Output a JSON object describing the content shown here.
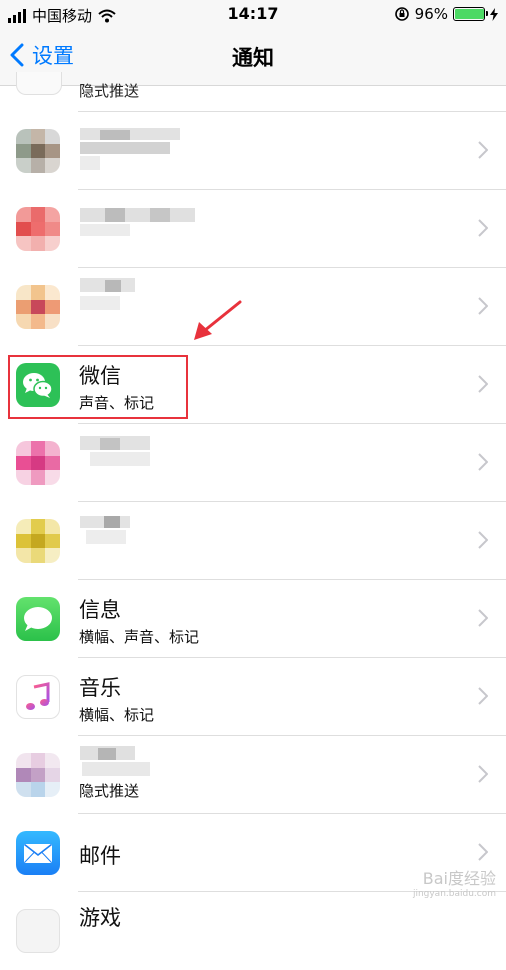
{
  "status_bar": {
    "carrier": "中国移动",
    "time": "14:17",
    "battery_pct": "96%",
    "battery_level": 0.96
  },
  "nav": {
    "back_label": "设置",
    "title": "通知"
  },
  "partial_top_row": {
    "subtitle": "隐式推送"
  },
  "rows": [
    {
      "name": "",
      "subtitle": "",
      "blurred": true
    },
    {
      "name": "",
      "subtitle": "",
      "blurred": true
    },
    {
      "name": "",
      "subtitle": "",
      "blurred": true
    },
    {
      "name": "微信",
      "subtitle": "声音、标记",
      "icon": "wechat-icon",
      "highlighted": true
    },
    {
      "name": "",
      "subtitle": "",
      "blurred": true
    },
    {
      "name": "",
      "subtitle": "",
      "blurred": true
    },
    {
      "name": "信息",
      "subtitle": "横幅、声音、标记",
      "icon": "messages-icon"
    },
    {
      "name": "音乐",
      "subtitle": "横幅、标记",
      "icon": "music-icon"
    },
    {
      "name": "",
      "subtitle": "隐式推送",
      "blurred": true
    },
    {
      "name": "邮件",
      "subtitle": "",
      "icon": "mail-icon"
    },
    {
      "name": "游戏",
      "subtitle": "",
      "icon": "game-center-icon"
    }
  ],
  "watermark": {
    "main": "Bai度经验",
    "sub": "jingyan.baidu.com"
  },
  "colors": {
    "accent": "#007aff",
    "highlight_box": "#e8323c",
    "battery": "#4cd964"
  }
}
